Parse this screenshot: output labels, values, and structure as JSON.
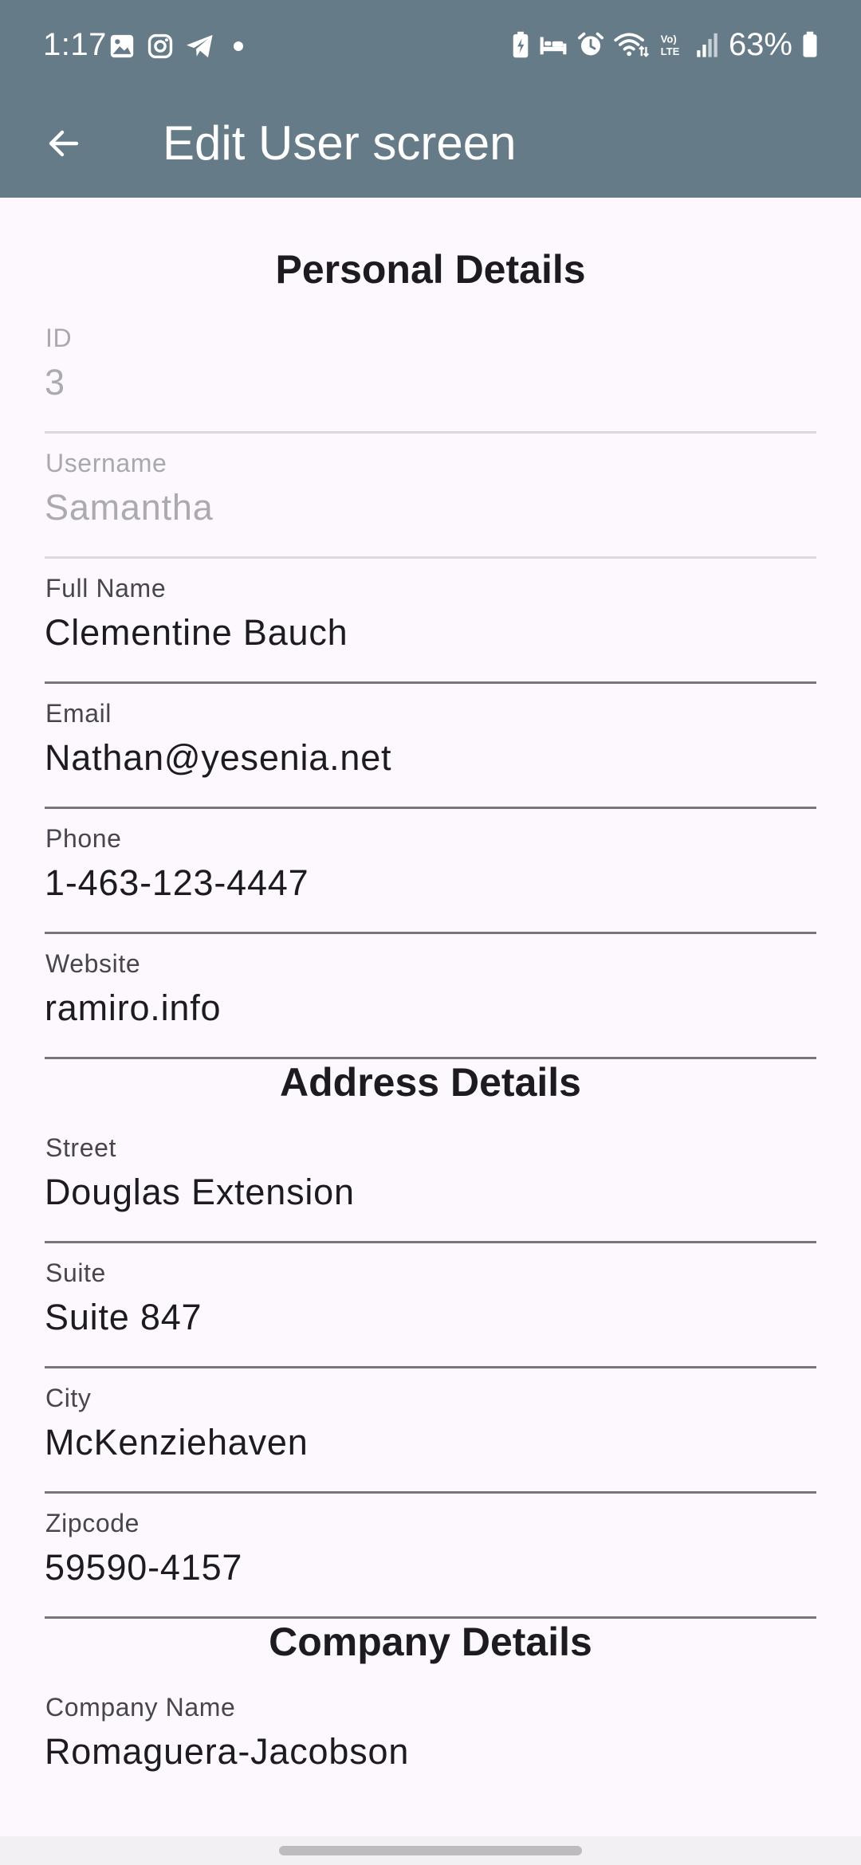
{
  "status_bar": {
    "time": "1:17",
    "battery_percent": "63%",
    "left_icons": [
      "gallery-icon",
      "instagram-icon",
      "telegram-icon",
      "dot-icon"
    ],
    "right_icons": [
      "battery-saver-icon",
      "sleep-mode-icon",
      "alarm-icon",
      "wifi-icon",
      "volte-icon",
      "signal-icon",
      "battery-icon"
    ]
  },
  "app_bar": {
    "title": "Edit User screen",
    "back_icon": "arrow-back-icon",
    "background_color": "#667b88"
  },
  "sections": {
    "personal": {
      "title": "Personal Details"
    },
    "address": {
      "title": "Address Details"
    },
    "company": {
      "title": "Company Details"
    }
  },
  "fields": {
    "id": {
      "label": "ID",
      "value": "3",
      "enabled": false
    },
    "username": {
      "label": "Username",
      "value": "Samantha",
      "enabled": false
    },
    "full_name": {
      "label": "Full Name",
      "value": "Clementine Bauch",
      "enabled": true
    },
    "email": {
      "label": "Email",
      "value": "Nathan@yesenia.net",
      "enabled": true
    },
    "phone": {
      "label": "Phone",
      "value": "1-463-123-4447",
      "enabled": true
    },
    "website": {
      "label": "Website",
      "value": "ramiro.info",
      "enabled": true
    },
    "street": {
      "label": "Street",
      "value": "Douglas Extension",
      "enabled": true
    },
    "suite": {
      "label": "Suite",
      "value": "Suite 847",
      "enabled": true
    },
    "city": {
      "label": "City",
      "value": "McKenziehaven",
      "enabled": true
    },
    "zipcode": {
      "label": "Zipcode",
      "value": "59590-4157",
      "enabled": true
    },
    "company_name": {
      "label": "Company Name",
      "value": "Romaguera-Jacobson",
      "enabled": true
    }
  }
}
